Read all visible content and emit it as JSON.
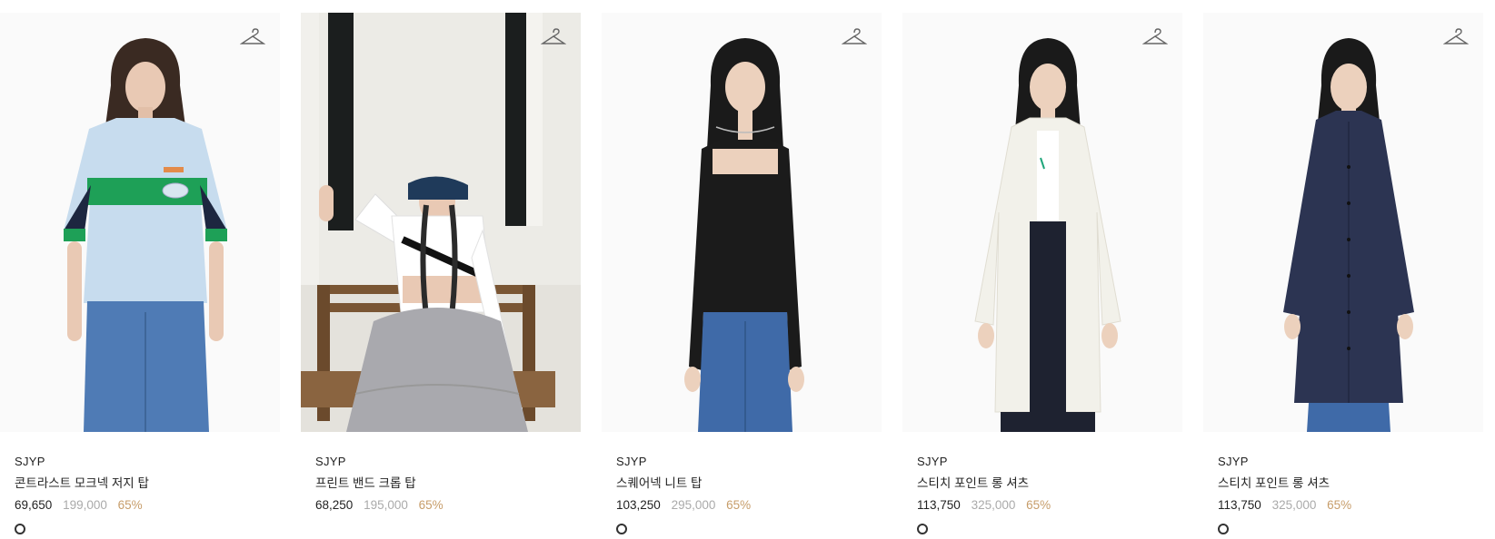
{
  "products": [
    {
      "brand": "SJYP",
      "name": "콘트라스트 모크넥 저지 탑",
      "price": "69,650",
      "original_price": "199,000",
      "discount": "65%",
      "image": "model wearing light blue mock-neck jersey top with green stripe and jeans",
      "colors": [
        "#222222"
      ]
    },
    {
      "brand": "SJYP",
      "name": "프린트 밴드 크롭 탑",
      "price": "68,250",
      "original_price": "195,000",
      "discount": "65%",
      "image": "model seated on wooden bench wearing white crop top, denim bucket hat and grey tulle skirt",
      "colors": []
    },
    {
      "brand": "SJYP",
      "name": "스퀘어넥 니트 탑",
      "price": "103,250",
      "original_price": "295,000",
      "discount": "65%",
      "image": "model wearing black square-neck knit top and jeans",
      "colors": [
        "#222222"
      ]
    },
    {
      "brand": "SJYP",
      "name": "스티치 포인트 롱 셔츠",
      "price": "113,750",
      "original_price": "325,000",
      "discount": "65%",
      "image": "model wearing long ivory shirt over white tee and black pants",
      "colors": [
        "#222222"
      ]
    },
    {
      "brand": "SJYP",
      "name": "스티치 포인트 롱 셔츠",
      "price": "113,750",
      "original_price": "325,000",
      "discount": "65%",
      "image": "model wearing long navy shirt dress with jeans",
      "colors": [
        "#222222"
      ]
    }
  ],
  "icons": {
    "wishlist": "hanger-icon"
  }
}
